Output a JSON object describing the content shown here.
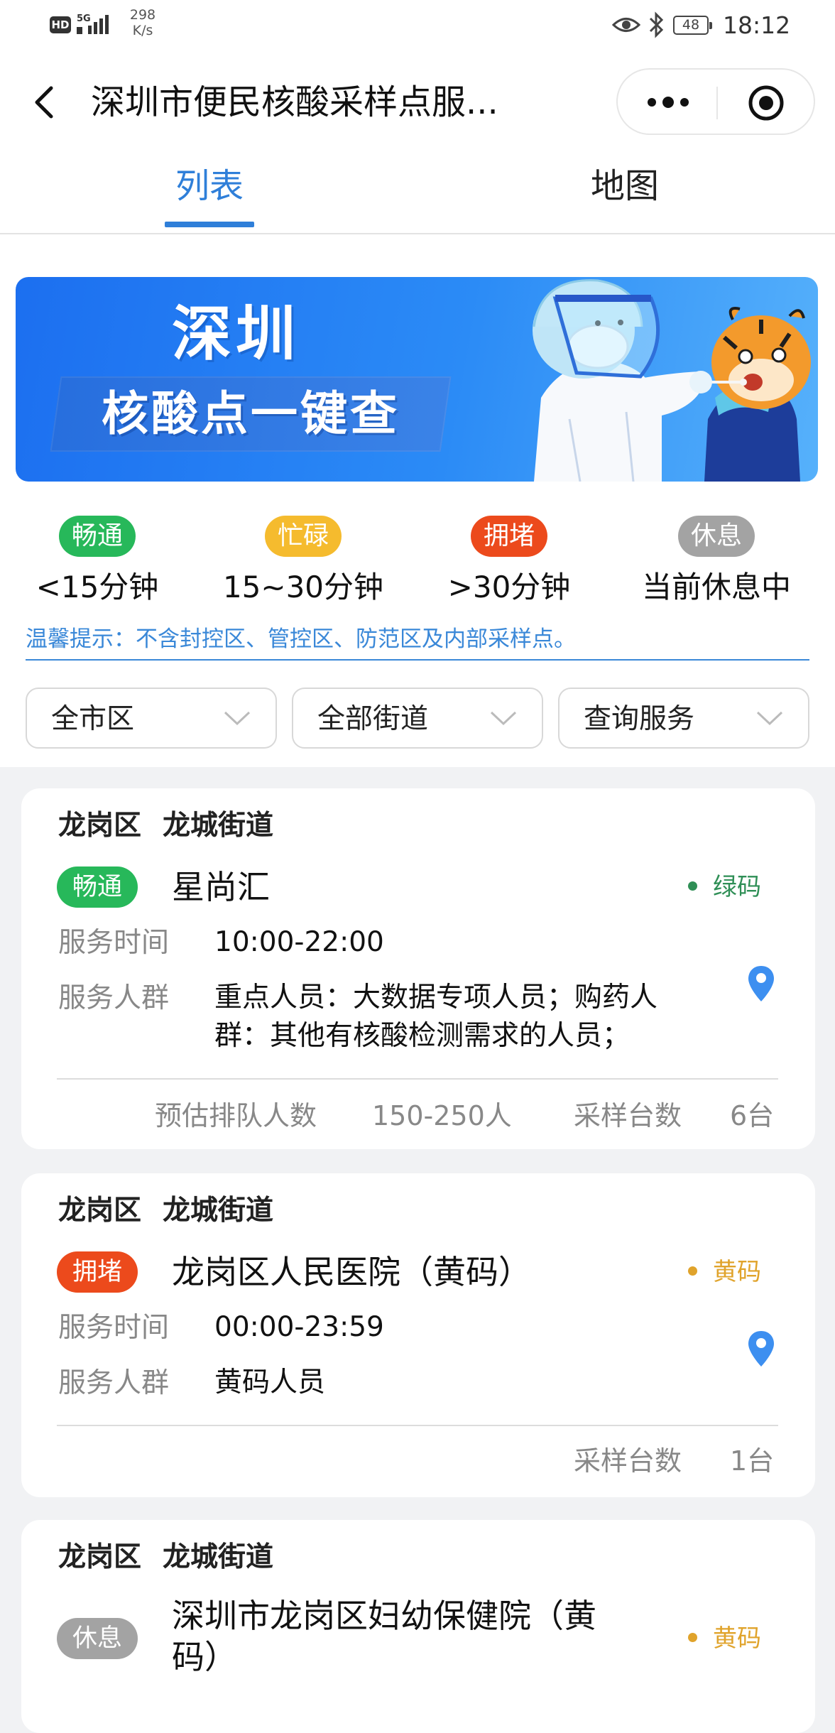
{
  "status_bar": {
    "hd": "HD",
    "network": "5G",
    "speed_value": "298",
    "speed_unit": "K/s",
    "battery": "48",
    "time": "18:12"
  },
  "title_bar": {
    "title": "深圳市便民核酸采样点服..."
  },
  "tabs": [
    {
      "label": "列表",
      "active": true
    },
    {
      "label": "地图",
      "active": false
    }
  ],
  "banner": {
    "line1": "深圳",
    "line2": "核酸点一键查"
  },
  "legend": [
    {
      "status": "畅通",
      "desc": "<15分钟",
      "color": "#27b85a"
    },
    {
      "status": "忙碌",
      "desc": "15~30分钟",
      "color": "#f5bb2e"
    },
    {
      "status": "拥堵",
      "desc": ">30分钟",
      "color": "#ec4a1c"
    },
    {
      "status": "休息",
      "desc": "当前休息中",
      "color": "#a3a3a3"
    }
  ],
  "tip": "温馨提示：不含封控区、管控区、防范区及内部采样点。",
  "filters": [
    {
      "label": "全市区"
    },
    {
      "label": "全部街道"
    },
    {
      "label": "查询服务"
    }
  ],
  "labels": {
    "service_time": "服务时间",
    "service_group": "服务人群",
    "queue": "预估排队人数",
    "stations": "采样台数"
  },
  "cards": [
    {
      "district": "龙岗区",
      "street": "龙城街道",
      "status": "畅通",
      "status_color": "#27b85a",
      "name": "星尚汇",
      "code": "绿码",
      "code_color": "#2f8f56",
      "service_time": "10:00-22:00",
      "service_group": "重点人员：大数据专项人员；购药人群：其他有核酸检测需求的人员；",
      "queue": "150-250人",
      "stations": "6台"
    },
    {
      "district": "龙岗区",
      "street": "龙城街道",
      "status": "拥堵",
      "status_color": "#ec4a1c",
      "name": "龙岗区人民医院（黄码）",
      "code": "黄码",
      "code_color": "#e0a32b",
      "service_time": "00:00-23:59",
      "service_group": "黄码人员",
      "stations": "1台"
    },
    {
      "district": "龙岗区",
      "street": "龙城街道",
      "status": "休息",
      "status_color": "#a3a3a3",
      "name": "深圳市龙岗区妇幼保健院（黄码）",
      "code": "黄码",
      "code_color": "#e0a32b"
    }
  ]
}
